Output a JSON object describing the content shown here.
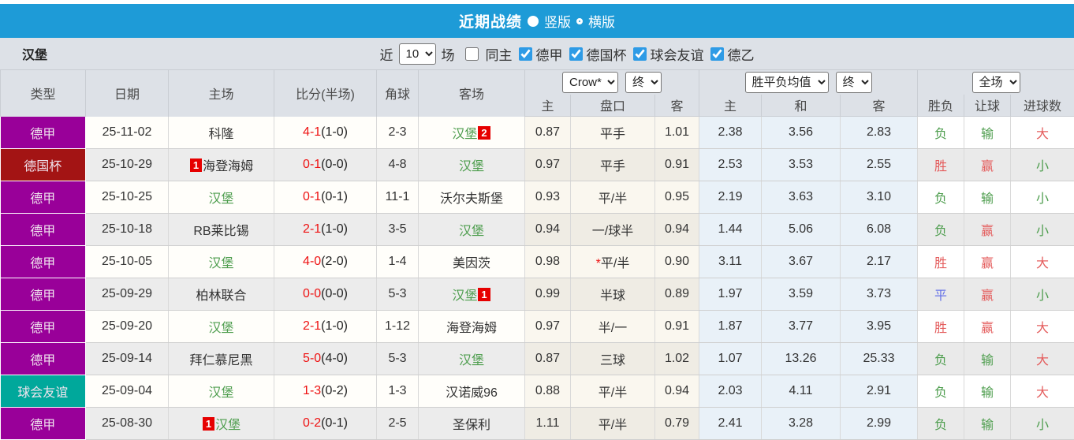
{
  "title_bar": {
    "title": "近期战绩",
    "layout_vertical_label": "竖版",
    "layout_horizontal_label": "横版"
  },
  "filter_bar": {
    "team": "汉堡",
    "near_label": "近",
    "count_value": "10",
    "matches_label": "场",
    "same_home_label": "同主",
    "leagues": [
      "德甲",
      "德国杯",
      "球会友谊",
      "德乙"
    ]
  },
  "table": {
    "headers": {
      "type": "类型",
      "date": "日期",
      "home": "主场",
      "score": "比分(半场)",
      "corner": "角球",
      "away": "客场",
      "odds_company": "Crow*",
      "odds_time": "终",
      "odds_sub": [
        "主",
        "盘口",
        "客"
      ],
      "avg_type": "胜平负均值",
      "avg_time": "终",
      "avg_sub": [
        "主",
        "和",
        "客"
      ],
      "scope": "全场",
      "result_sub": [
        "胜负",
        "让球",
        "进球数"
      ]
    },
    "colors": {
      "green": "#4d9d4d",
      "red": "#e45c5c",
      "blue": "#6673e8",
      "score_red": "#ee1111",
      "badge_red": "#e60000"
    },
    "rows": [
      {
        "league": "德甲",
        "color": "#990099",
        "date": "25-11-02",
        "home": "科隆",
        "home_green": false,
        "home_badge": "",
        "score": "4-1",
        "half": "(1-0)",
        "corner": "2-3",
        "away": "汉堡",
        "away_green": true,
        "away_badge": "2",
        "odds": [
          "0.87",
          "平手",
          "1.01"
        ],
        "star": false,
        "avg": [
          "2.38",
          "3.56",
          "2.83"
        ],
        "res": [
          [
            "负",
            "g"
          ],
          [
            "输",
            "g"
          ],
          [
            "大",
            "r"
          ]
        ]
      },
      {
        "league": "德国杯",
        "color": "#a31414",
        "date": "25-10-29",
        "home": "海登海姆",
        "home_green": false,
        "home_badge": "1",
        "score": "0-1",
        "half": "(0-0)",
        "corner": "4-8",
        "away": "汉堡",
        "away_green": true,
        "away_badge": "",
        "odds": [
          "0.97",
          "平手",
          "0.91"
        ],
        "star": false,
        "avg": [
          "2.53",
          "3.53",
          "2.55"
        ],
        "res": [
          [
            "胜",
            "r"
          ],
          [
            "赢",
            "r"
          ],
          [
            "小",
            "g"
          ]
        ]
      },
      {
        "league": "德甲",
        "color": "#990099",
        "date": "25-10-25",
        "home": "汉堡",
        "home_green": true,
        "home_badge": "",
        "score": "0-1",
        "half": "(0-1)",
        "corner": "11-1",
        "away": "沃尔夫斯堡",
        "away_green": false,
        "away_badge": "",
        "odds": [
          "0.93",
          "平/半",
          "0.95"
        ],
        "star": false,
        "avg": [
          "2.19",
          "3.63",
          "3.10"
        ],
        "res": [
          [
            "负",
            "g"
          ],
          [
            "输",
            "g"
          ],
          [
            "小",
            "g"
          ]
        ]
      },
      {
        "league": "德甲",
        "color": "#990099",
        "date": "25-10-18",
        "home": "RB莱比锡",
        "home_green": false,
        "home_badge": "",
        "score": "2-1",
        "half": "(1-0)",
        "corner": "3-5",
        "away": "汉堡",
        "away_green": true,
        "away_badge": "",
        "odds": [
          "0.94",
          "一/球半",
          "0.94"
        ],
        "star": false,
        "avg": [
          "1.44",
          "5.06",
          "6.08"
        ],
        "res": [
          [
            "负",
            "g"
          ],
          [
            "赢",
            "r"
          ],
          [
            "小",
            "g"
          ]
        ]
      },
      {
        "league": "德甲",
        "color": "#990099",
        "date": "25-10-05",
        "home": "汉堡",
        "home_green": true,
        "home_badge": "",
        "score": "4-0",
        "half": "(2-0)",
        "corner": "1-4",
        "away": "美因茨",
        "away_green": false,
        "away_badge": "",
        "odds": [
          "0.98",
          "平/半",
          "0.90"
        ],
        "star": true,
        "avg": [
          "3.11",
          "3.67",
          "2.17"
        ],
        "res": [
          [
            "胜",
            "r"
          ],
          [
            "赢",
            "r"
          ],
          [
            "大",
            "r"
          ]
        ]
      },
      {
        "league": "德甲",
        "color": "#990099",
        "date": "25-09-29",
        "home": "柏林联合",
        "home_green": false,
        "home_badge": "",
        "score": "0-0",
        "half": "(0-0)",
        "corner": "5-3",
        "away": "汉堡",
        "away_green": true,
        "away_badge": "1",
        "odds": [
          "0.99",
          "半球",
          "0.89"
        ],
        "star": false,
        "avg": [
          "1.97",
          "3.59",
          "3.73"
        ],
        "res": [
          [
            "平",
            "b"
          ],
          [
            "赢",
            "r"
          ],
          [
            "小",
            "g"
          ]
        ]
      },
      {
        "league": "德甲",
        "color": "#990099",
        "date": "25-09-20",
        "home": "汉堡",
        "home_green": true,
        "home_badge": "",
        "score": "2-1",
        "half": "(1-0)",
        "corner": "1-12",
        "away": "海登海姆",
        "away_green": false,
        "away_badge": "",
        "odds": [
          "0.97",
          "半/一",
          "0.91"
        ],
        "star": false,
        "avg": [
          "1.87",
          "3.77",
          "3.95"
        ],
        "res": [
          [
            "胜",
            "r"
          ],
          [
            "赢",
            "r"
          ],
          [
            "大",
            "r"
          ]
        ]
      },
      {
        "league": "德甲",
        "color": "#990099",
        "date": "25-09-14",
        "home": "拜仁慕尼黑",
        "home_green": false,
        "home_badge": "",
        "score": "5-0",
        "half": "(4-0)",
        "corner": "5-3",
        "away": "汉堡",
        "away_green": true,
        "away_badge": "",
        "odds": [
          "0.87",
          "三球",
          "1.02"
        ],
        "star": false,
        "avg": [
          "1.07",
          "13.26",
          "25.33"
        ],
        "res": [
          [
            "负",
            "g"
          ],
          [
            "输",
            "g"
          ],
          [
            "大",
            "r"
          ]
        ]
      },
      {
        "league": "球会友谊",
        "color": "#00a89b",
        "date": "25-09-04",
        "home": "汉堡",
        "home_green": true,
        "home_badge": "",
        "score": "1-3",
        "half": "(0-2)",
        "corner": "1-3",
        "away": "汉诺威96",
        "away_green": false,
        "away_badge": "",
        "odds": [
          "0.88",
          "平/半",
          "0.94"
        ],
        "star": false,
        "avg": [
          "2.03",
          "4.11",
          "2.91"
        ],
        "res": [
          [
            "负",
            "g"
          ],
          [
            "输",
            "g"
          ],
          [
            "大",
            "r"
          ]
        ]
      },
      {
        "league": "德甲",
        "color": "#990099",
        "date": "25-08-30",
        "home": "汉堡",
        "home_green": true,
        "home_badge": "1",
        "score": "0-2",
        "half": "(0-1)",
        "corner": "2-5",
        "away": "圣保利",
        "away_green": false,
        "away_badge": "",
        "odds": [
          "1.11",
          "平/半",
          "0.79"
        ],
        "star": false,
        "avg": [
          "2.41",
          "3.28",
          "2.99"
        ],
        "res": [
          [
            "负",
            "g"
          ],
          [
            "输",
            "g"
          ],
          [
            "小",
            "g"
          ]
        ]
      }
    ]
  }
}
